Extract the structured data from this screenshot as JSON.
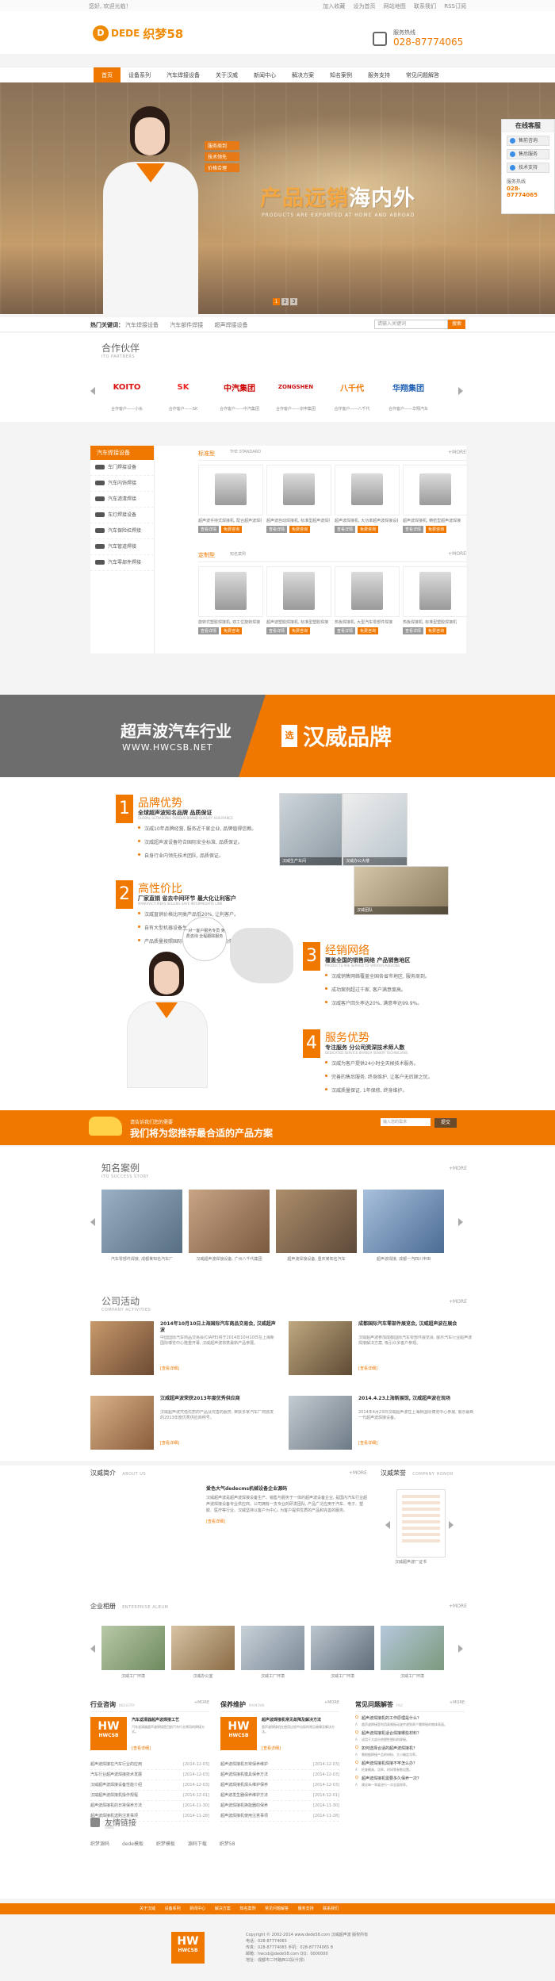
{
  "topbar": {
    "welcome": "您好, 欢迎光临！",
    "links": [
      "加入收藏",
      "设为首页",
      "网站地图",
      "联系我们",
      "RSS订阅"
    ]
  },
  "header": {
    "logo_mark": "D",
    "logo_text": "DEDE",
    "logo_cn": "织梦58",
    "hotline_label": "服务热线",
    "hotline_number": "028-87774065"
  },
  "nav": {
    "items": [
      {
        "label": "首页",
        "active": true
      },
      {
        "label": "设备系列"
      },
      {
        "label": "汽车焊接设备"
      },
      {
        "label": "关于汉威"
      },
      {
        "label": "新闻中心"
      },
      {
        "label": "解决方案"
      },
      {
        "label": "知名案例"
      },
      {
        "label": "服务支持"
      },
      {
        "label": "常见问题解答"
      }
    ]
  },
  "banner": {
    "tags": [
      "服务周到",
      "技术领先",
      "价格合理"
    ],
    "slogan_orange": "产品远销",
    "slogan_white": "海内外",
    "slogan_en": "PRODUCTS ARE EXPORTED AT HOME AND ABROAD",
    "dots": [
      "1",
      "2",
      "3"
    ]
  },
  "service": {
    "title": "在线客服",
    "qq": [
      "售前咨询",
      "售后服务",
      "技术支持"
    ],
    "label": "服务热线",
    "phone": "028-87774065"
  },
  "crumb": {
    "hot_label": "热门关键词：",
    "hot_items": [
      "汽车焊接设备",
      "汽车部件焊接",
      "超声焊接设备"
    ],
    "search_placeholder": "请输入关键词",
    "search_button": "搜索"
  },
  "partners": {
    "title": "合作伙伴",
    "subtitle": "ITO PARTNERS",
    "items": [
      {
        "logo": "KOITO",
        "color": "#d11",
        "name": "合作客户——小糸"
      },
      {
        "logo": "SK",
        "color": "#e22",
        "name": "合作客户——SK"
      },
      {
        "logo": "中汽集团",
        "color": "#c00",
        "name": "合作客户——中汽集团"
      },
      {
        "logo": "ZONGSHEN",
        "color": "#c11",
        "name": "合作客户——宗申集团"
      },
      {
        "logo": "八千代",
        "color": "#f07800",
        "name": "合作客户——八千代"
      },
      {
        "logo": "华翔集团",
        "color": "#1d5fb3",
        "name": "合作客户——华翔汽车"
      }
    ]
  },
  "products": {
    "sidebar_title": "汽车焊接设备",
    "sidebar_items": [
      "车门焊接设备",
      "汽车内饰焊接",
      "汽车滤清焊接",
      "车灯焊接设备",
      "汽车保险杠焊接",
      "汽车管道焊接",
      "汽车零部件焊接"
    ],
    "tab1": "标准型",
    "tab1_sub": "THE STANDARD",
    "tab2": "定制型",
    "tab2_sub": "知名案例",
    "more": "+MORE",
    "row1": [
      "超声波手持式焊接机, 配合超声波焊接",
      "超声波自动焊接机, 标准型超声波焊接",
      "超声波焊接机, 大功率超声波焊接设备",
      "超声波焊接机, 精密型超声波焊接"
    ],
    "row2": [
      "旋转式塑胶焊接机, 双工位旋转焊接",
      "超声波塑胶焊接机, 标准型塑胶焊接",
      "热板焊接机, 大型汽车零部件焊接",
      "热板焊接机, 标准型塑胶焊接机"
    ],
    "btn_detail": "查看详情",
    "btn_consult": "免费咨询"
  },
  "brand": {
    "line_cn": "超声波汽车行业",
    "line_en": "WWW.HWCSB.NET",
    "xuan": "选",
    "brand_name": "汉威品牌"
  },
  "advantages": {
    "blocks": [
      {
        "num": "1",
        "title": "品牌优势",
        "sub": "全球超声波知名品牌 品质保证",
        "en": "GLOBAL ULTRASONIC FAMOUS BRAND QUALITY ASSURANCE",
        "bullets": [
          "汉威10年品牌经营, 服务近千家企业, 品牌值得信赖。",
          "汉威超声波设备符合国际安全标准, 品质保证。",
          "自身行业内领先技术团队, 品质保证。"
        ]
      },
      {
        "num": "2",
        "title": "高性价比",
        "sub": "厂家直销 省去中间环节 最大化让利客户",
        "en": "MANUFACTURERS SELLING SAVE INTERMEDIATE LINK",
        "bullets": [
          "汉威直销价格比同类产品低20%, 让利客户。",
          "自有大型机器设备生产线, 控制成本。",
          "产品质量按照国际标准, 产品价格比国内低。"
        ]
      },
      {
        "num": "3",
        "title": "经销网络",
        "sub": "覆盖全国的销售网络 产品销售地区",
        "en": "PRODUCTS ARE SERVED TO VARIOUS REGIONS",
        "bullets": [
          "汉威销售网络覆盖全国各省市地区, 服务周到。",
          "成功案例超过千家, 客户满意度高。",
          "汉威客户回头率达20%, 满意率达99.9%。"
        ]
      },
      {
        "num": "4",
        "title": "服务优势",
        "sub": "专注服务 分公司资深技术师人数",
        "en": "DEDICATED SERVICE BRANCH SENIOR TECHNICIANS",
        "bullets": [
          "汉威为客户提供24小时全天候技术服务。",
          "完善的售后服务, 终身维护, 让客户无后顾之忧。",
          "汉威质量保证, 1年保修, 终身维护。"
        ]
      }
    ],
    "bubble": "一对一客户服务专员 免费咨询 全程跟踪服务",
    "photo_captions": [
      "汉威生产车间",
      "汉威办公大楼",
      "汉威团队"
    ]
  },
  "cta": {
    "line1": "请告诉我们您的需要",
    "line2": "我们将为您推荐最合适的产品方案",
    "input_placeholder": "输入您的需求",
    "button": "提交"
  },
  "cases": {
    "title": "知名案例",
    "subtitle": "ITO SUCCESS STORY",
    "more": "+MORE",
    "items": [
      "汽车零部件焊接, 成都某知名汽车厂",
      "汉威超声波焊接设备, 广州八千代集团",
      "超声波焊接设备, 重庆某知名汽车",
      "超声波焊接, 成都一汽四川丰田"
    ]
  },
  "activities": {
    "title": "公司活动",
    "subtitle": "COMPANY ACTIVITIES",
    "more": "+MORE",
    "items": [
      {
        "title": "2014年10月10日上海国际汽车商品交易会, 汉威超声波",
        "text": "中国国际汽车商品交易会(CIAPE)将于2014年10月10日在上海新国际博览中心隆重开幕, 汉威超声波将携最新产品参展。",
        "link": "[查看详细]"
      },
      {
        "title": "成都国际汽车零部件展览会, 汉威超声波在展会",
        "text": "汉威超声波参加成都国际汽车零部件展览会, 展示汽车行业超声波焊接解决方案, 吸引众多客户参观。",
        "link": "[查看详细]"
      },
      {
        "title": "汉威超声波荣获2013年度优秀供应商",
        "text": "汉威超声波凭借优质的产品及完善的服务, 荣获多家汽车厂商颁发的2013年度优秀供应商称号。",
        "link": "[查看详细]"
      },
      {
        "title": "2014.4.23上海新展馆, 汉威超声波在现场",
        "text": "2014年4月23日汉威超声波在上海新国际博览中心参展, 展示最新一代超声波焊接设备。",
        "link": "[查看详细]"
      }
    ]
  },
  "intro": {
    "title": "汉威简介",
    "subtitle": "ABOUT US",
    "more": "+MORE",
    "heading": "爱色大气dedecms机械设备企业源码",
    "text": "汉威超声波是超声波焊接设备生产、销售与服务于一体的超声波设备企业, 是国内汽车行业超声波焊接设备专业供应商。公司拥有一支专业的研发团队, 产品广泛应用于汽车、电子、塑胶、医疗等行业。汉威坚持以客户为中心, 为客户提供优质的产品和完善的服务。",
    "link": "[查看详细]",
    "honor_title": "汉威荣誉",
    "honor_subtitle": "COMPANY HONOR",
    "honor_caption": "汉威超声波厂证书"
  },
  "environment": {
    "title": "企业相册",
    "subtitle": "ENTERPRISE ALBUM",
    "more": "+MORE",
    "items": [
      "汉威工厂环境",
      "汉威办公室",
      "汉威工厂环境",
      "汉威工厂环境",
      "汉威工厂环境"
    ]
  },
  "columns": {
    "industry": {
      "title": "行业咨询",
      "subtitle": "INDUSTRY",
      "more": "+MORE",
      "feature_title": "汽车滤清器超声波焊接工艺",
      "feature_text": "汽车滤清器超声波焊接是目前汽车行业常用的焊接方式。",
      "feature_link": "[查看详细]",
      "list": [
        {
          "t": "超声波焊接在汽车行业的应用",
          "d": "[2014-12-03]"
        },
        {
          "t": "汽车行业超声波焊接技术发展",
          "d": "[2014-12-03]"
        },
        {
          "t": "汉威超声波焊接设备性能介绍",
          "d": "[2014-12-03]"
        },
        {
          "t": "汉威超声波焊接机操作规程",
          "d": "[2014-12-01]"
        },
        {
          "t": "超声波焊接机的日常保养方法",
          "d": "[2014-11-30]"
        },
        {
          "t": "超声波焊接机选购注意事项",
          "d": "[2014-11-28]"
        }
      ]
    },
    "maintain": {
      "title": "保养维护",
      "subtitle": "MAINTAIN",
      "more": "+MORE",
      "feature_title": "超声波焊接机常见故障及解决方法",
      "feature_text": "超声波焊接机在使用过程中出现的常见故障及解决方法。",
      "feature_link": "[查看详细]",
      "list": [
        {
          "t": "超声波焊接机日常保养维护",
          "d": "[2014-12-03]"
        },
        {
          "t": "超声波焊接机模具保养方法",
          "d": "[2014-12-03]"
        },
        {
          "t": "超声波焊接机焊头维护保养",
          "d": "[2014-12-03]"
        },
        {
          "t": "超声波发生器保养维护方法",
          "d": "[2014-12-01]"
        },
        {
          "t": "超声波焊接机换能器的保养",
          "d": "[2014-11-30]"
        },
        {
          "t": "超声波焊接机使用注意事项",
          "d": "[2014-11-28]"
        }
      ]
    },
    "faq": {
      "title": "常见问题解答",
      "subtitle": "FAQ",
      "more": "+MORE",
      "items": [
        {
          "q": "超声波焊接机的工作原理是什么？",
          "a": "超声波焊接是利用高频振动波传递到两个需焊接的物体表面。"
        },
        {
          "q": "超声波焊接机适合焊接哪些材料？",
          "a": "适用于大部分热塑性塑料的焊接。"
        },
        {
          "q": "如何选择合适的超声波焊接机？",
          "a": "需根据焊接产品的材料、大小确定功率。"
        },
        {
          "q": "超声波焊接机焊接不牢怎么办？",
          "a": "检查模具、功率、时间等参数设置。"
        },
        {
          "q": "超声波焊接机需要多久保养一次？",
          "a": "建议每一季度进行一次全面保养。"
        }
      ]
    }
  },
  "links": {
    "title": "友情链接",
    "subtitle": "LINKS",
    "items": [
      "织梦源码",
      "dede模板",
      "织梦模板",
      "源码下载",
      "织梦58"
    ]
  },
  "footer_nav": [
    "关于汉威",
    "设备系列",
    "新闻中心",
    "解决方案",
    "知名案例",
    "常见问题解答",
    "服务支持",
    "联系我们"
  ],
  "footer": {
    "logo_hw": "HW",
    "logo_text": "HWCSB",
    "lines": [
      "Copyright © 2002-2014 www.dede58.com  汉威超声波  版权所有",
      "电话：028-87774065",
      "传真：028-87774065  手机：028-87774065 8",
      "邮箱：hwcsb@dede58.com  QQ：0000000",
      "地址：成都市二环路西三段(什邡)"
    ]
  },
  "colors": {
    "accent": "#f07800",
    "dark": "#6d6d6d"
  }
}
